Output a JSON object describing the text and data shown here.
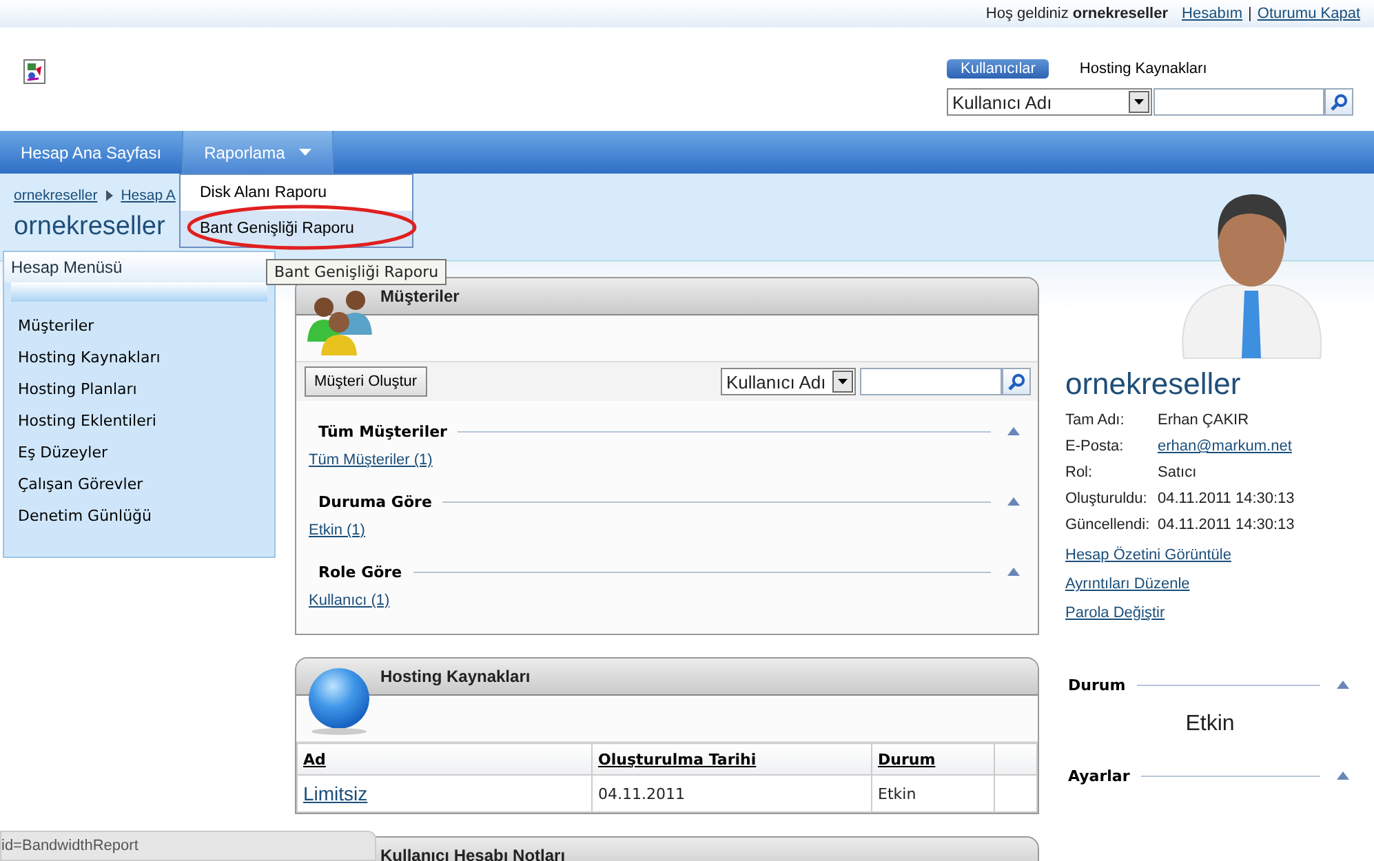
{
  "top_bar": {
    "greeting": "Hoş geldiniz **ornekreseller**",
    "links": [
      "Hesabım",
      "Oturumu Kapat"
    ],
    "separator": "|"
  },
  "search": {
    "tabs": [
      {
        "label": "Kullanıcılar",
        "selected": true
      },
      {
        "label": "Hosting Kaynakları",
        "selected": false
      }
    ],
    "field": "Kullanıcı Adı"
  },
  "nav": [
    {
      "label": "Hesap Ana Sayfası",
      "selected": false,
      "dropdown": false
    },
    {
      "label": "Raporlama",
      "selected": true,
      "dropdown": true
    }
  ],
  "menu_popup": {
    "items": [
      {
        "label": "Disk Alanı Raporu",
        "selected": false
      },
      {
        "label": "Bant Genişliği Raporu",
        "selected": true
      }
    ]
  },
  "tooltip": "Bant Genişliği Raporu",
  "breadcrumbs": [
    "ornekreseller",
    "Hesap A"
  ],
  "page_title": "ornekreseller",
  "sidebar": {
    "title": "Hesap Menüsü",
    "items": [
      "Müşteriler",
      "Hosting Kaynakları",
      "Hosting Planları",
      "Hosting Eklentileri",
      "Eş Düzeyler",
      "Çalışan Görevler",
      "Denetim Günlüğü"
    ]
  },
  "customers_panel": {
    "title": "Müşteriler",
    "create_button": "Müşteri Oluştur",
    "search_field": "Kullanıcı Adı",
    "groups": [
      {
        "heading": "Tüm Müşteriler",
        "expanded": true,
        "links": [
          "Tüm Müşteriler (1)"
        ]
      },
      {
        "heading": "Duruma Göre",
        "expanded": true,
        "links": [
          "Etkin (1)"
        ]
      },
      {
        "heading": "Role Göre",
        "expanded": true,
        "links": [
          "Kullanıcı (1)"
        ]
      }
    ]
  },
  "resources_panel": {
    "title": "Hosting Kaynakları",
    "table": {
      "columns": [
        "Ad",
        "Oluşturulma Tarihi",
        "Durum"
      ],
      "rows": [
        [
          "Limitsiz",
          "04.11.2011",
          "Etkin"
        ]
      ]
    }
  },
  "notes_panel": {
    "title": "Kullanıcı Hesabı Notları"
  },
  "profile": {
    "name": "ornekreseller",
    "fields": [
      {
        "label": "Tam Adı:",
        "value": "Erhan ÇAKIR",
        "kind": "text"
      },
      {
        "label": "E-Posta:",
        "value": "erhan@markum.net",
        "kind": "link"
      },
      {
        "label": "Rol:",
        "value": "Satıcı",
        "kind": "text"
      },
      {
        "label": "Oluşturuldu:",
        "value": "04.11.2011 14:30:13",
        "kind": "text"
      },
      {
        "label": "Güncellendi:",
        "value": "04.11.2011 14:30:13",
        "kind": "text"
      }
    ],
    "links": [
      "Hesap Özetini Görüntüle",
      "Ayrıntıları Düzenle",
      "Parola Değiştir"
    ],
    "sections": [
      {
        "heading": "Durum",
        "expanded": true,
        "value": "Etkin"
      },
      {
        "heading": "Ayarlar",
        "expanded": true
      }
    ]
  },
  "status_bar": "id=BandwidthReport"
}
